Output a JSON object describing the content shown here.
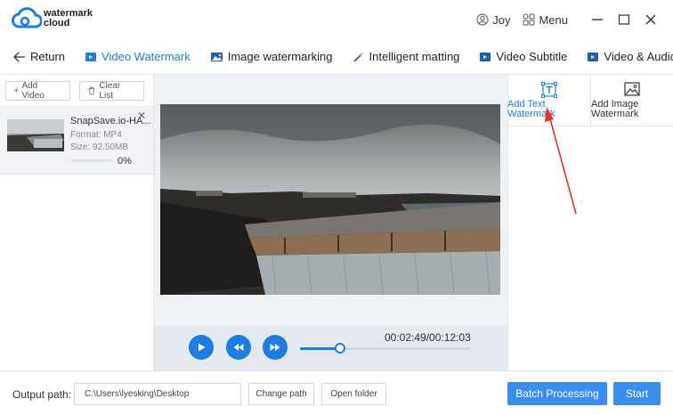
{
  "app": {
    "logo_line1": "watermark",
    "logo_line2": "cloud",
    "user_name": "Joy",
    "menu_label": "Menu",
    "brand_color": "#1e7de0"
  },
  "tabs": {
    "return_label": "Return",
    "items": [
      {
        "label": "Video Watermark",
        "icon": "video-icon",
        "active": true
      },
      {
        "label": "Image watermarking",
        "icon": "image-icon",
        "active": false
      },
      {
        "label": "Intelligent matting",
        "icon": "magic-wand-icon",
        "active": false
      },
      {
        "label": "Video Subtitle",
        "icon": "video-icon",
        "active": false
      },
      {
        "label": "Video & Audio Sepa",
        "icon": "video-icon",
        "active": false
      }
    ]
  },
  "filelist": {
    "add_video_label": "Add Video",
    "clear_list_label": "Clear List",
    "file": {
      "name": "SnapSave.io-HA...",
      "format": "Format:  MP4",
      "size": "Size:  92.50MB",
      "progress_text": "0%",
      "progress": 0
    }
  },
  "player": {
    "timecode": "00:02:49/00:12:03",
    "position_fraction": 0.234
  },
  "watermark_options": {
    "text_label_line1": "Add Text",
    "text_label_line2": "Watermark",
    "image_label_line1": "Add Image",
    "image_label_line2": "Watermark"
  },
  "footer": {
    "output_label": "Output path:",
    "output_path": "C:\\Users\\lyesking\\Desktop",
    "change_path_label": "Change path",
    "open_folder_label": "Open folder",
    "batch_label": "Batch Processing",
    "start_label": "Start"
  }
}
